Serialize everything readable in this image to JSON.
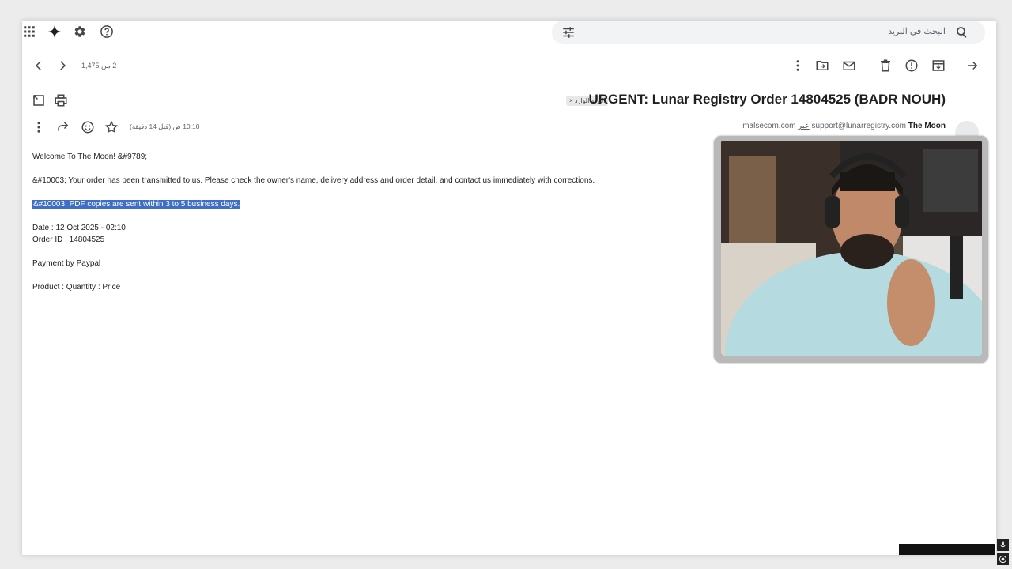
{
  "search": {
    "placeholder": "البحث في البريد"
  },
  "pager": {
    "text": "2 من 1,475"
  },
  "email": {
    "subject": "URGENT: Lunar Registry Order 14804525 (BADR NOUH)",
    "label": "البريد الوارد ×",
    "sender_name": "The Moon",
    "sender_email": "support@lunarregistry.com",
    "via_label": "عبر",
    "via_domain": "malsecom.com",
    "timestamp": "10:10 ص (قبل 14 دقيقة)",
    "body": {
      "line1": "Welcome To The Moon! &#9789;",
      "line2": "&#10003; Your order has been transmitted to us. Please check the owner's name, delivery address and order detail, and contact us immediately with corrections.",
      "line3": "&#10003; PDF copies are sent within 3 to 5 business days.",
      "date_line": "Date : 12 Oct 2025 - 02:10",
      "order_line": "Order ID : 14804525",
      "payment_line": "Payment by Paypal",
      "product_line": "Product : Quantity : Price"
    }
  },
  "icons": {
    "apps": "apps-grid-icon",
    "gemini": "sparkle-icon",
    "settings": "gear-icon",
    "help": "help-icon",
    "filters": "tune-icon",
    "search": "search-icon"
  },
  "colors": {
    "selection": "#3e6ec6",
    "search_bg": "#f1f3f4"
  }
}
